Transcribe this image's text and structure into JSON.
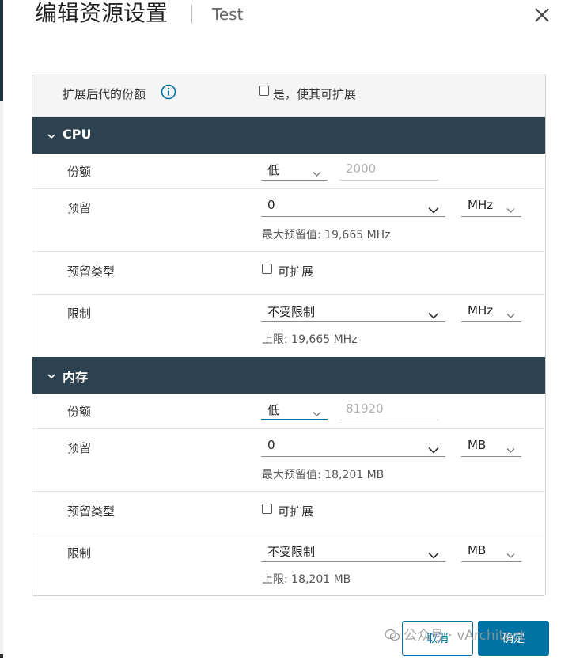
{
  "dialog": {
    "title": "编辑资源设置",
    "subtitle": "Test",
    "close_label": "×"
  },
  "expandable": {
    "label": "扩展后代的份额",
    "checkbox_label": "是，使其可扩展",
    "checked": false
  },
  "cpu": {
    "section_title": "CPU",
    "shares": {
      "label": "份额",
      "level": "低",
      "value": "2000"
    },
    "reservation": {
      "label": "预留",
      "value": "0",
      "unit": "MHz",
      "hint": "最大预留值: 19,665 MHz"
    },
    "reservation_type": {
      "label": "预留类型",
      "checkbox_label": "可扩展",
      "checked": false
    },
    "limit": {
      "label": "限制",
      "value": "不受限制",
      "unit": "MHz",
      "hint": "上限: 19,665 MHz"
    }
  },
  "memory": {
    "section_title": "内存",
    "shares": {
      "label": "份额",
      "level": "低",
      "value": "81920"
    },
    "reservation": {
      "label": "预留",
      "value": "0",
      "unit": "MB",
      "hint": "最大预留值: 18,201 MB"
    },
    "reservation_type": {
      "label": "预留类型",
      "checkbox_label": "可扩展",
      "checked": false
    },
    "limit": {
      "label": "限制",
      "value": "不受限制",
      "unit": "MB",
      "hint": "上限: 18,201 MB"
    }
  },
  "footer": {
    "cancel_label": "取消",
    "ok_label": "确定",
    "watermark": "公众号 · vArchitect"
  },
  "colors": {
    "section_header": "#2d4250",
    "accent": "#0072a3"
  }
}
